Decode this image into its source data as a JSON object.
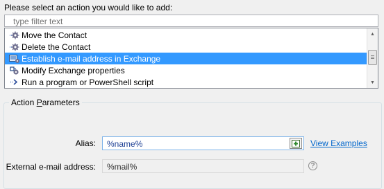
{
  "prompt": "Please select an action you would like to add:",
  "filter": {
    "placeholder": "type filter text"
  },
  "actions": [
    {
      "label": "Move the Contact",
      "icon": "gear-move-icon"
    },
    {
      "label": "Delete the Contact",
      "icon": "gear-delete-icon"
    },
    {
      "label": "Establish e-mail address in Exchange",
      "icon": "exchange-mailbox-icon",
      "selected": true
    },
    {
      "label": "Modify Exchange properties",
      "icon": "exchange-properties-icon"
    },
    {
      "label": "Run a program or PowerShell script",
      "icon": "powershell-icon"
    }
  ],
  "params": {
    "title_prefix": "Action ",
    "title_mnemonic": "P",
    "title_rest": "arameters",
    "alias_label": "Alias:",
    "alias_value": "%name%",
    "view_examples": "View Examples",
    "ext_label": "External e-mail address:",
    "ext_value": "%mail%",
    "help_glyph": "?"
  },
  "colors": {
    "selection": "#3399ff",
    "link": "#0066cc",
    "value_text": "#1c3f94"
  }
}
